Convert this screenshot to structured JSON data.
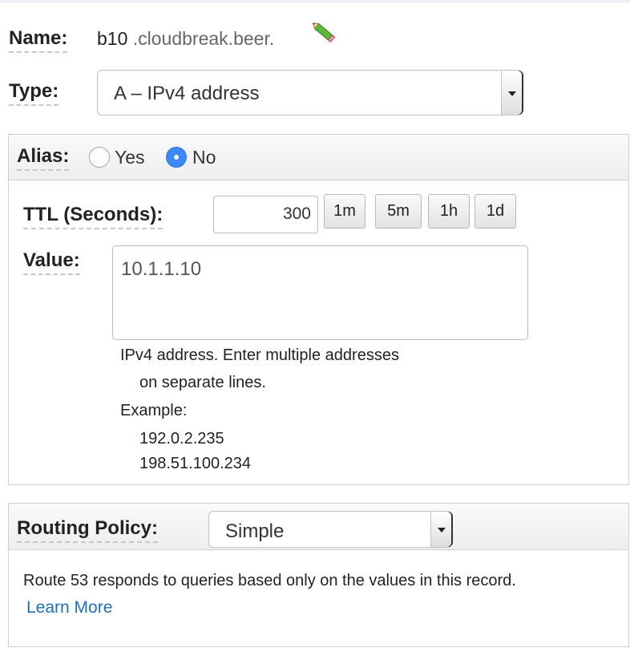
{
  "record": {
    "name_label": "Name:",
    "name_prefix": "b10",
    "name_domain": ".cloudbreak.beer.",
    "type_label": "Type:",
    "type_value": "A – IPv4 address"
  },
  "alias": {
    "label": "Alias:",
    "yes_label": "Yes",
    "no_label": "No",
    "selected": "No"
  },
  "ttl": {
    "label": "TTL (Seconds):",
    "value": "300",
    "buttons": [
      "1m",
      "5m",
      "1h",
      "1d"
    ]
  },
  "value": {
    "label": "Value:",
    "text": "10.1.1.10",
    "help": [
      "IPv4 address. Enter multiple addresses",
      "on separate lines.",
      "Example:",
      "192.0.2.235",
      "198.51.100.234"
    ]
  },
  "routing": {
    "label": "Routing Policy:",
    "value": "Simple",
    "description": "Route 53 responds to queries based only on the values in this record.",
    "learn_more": "Learn More"
  },
  "icons": {
    "edit": "pencil-icon",
    "dropdown": "chevron-down-icon"
  },
  "colors": {
    "radio_selected": "#3d8af7",
    "link": "#1f6fb5"
  }
}
